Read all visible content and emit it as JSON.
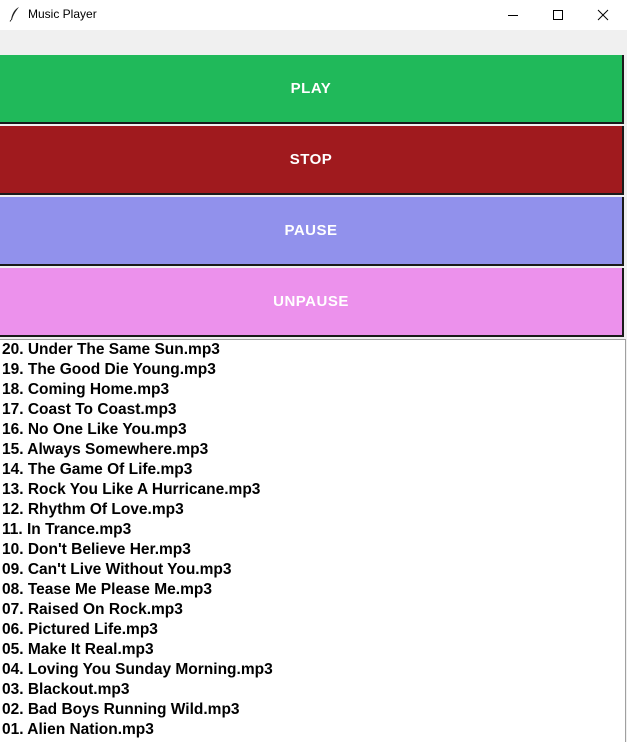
{
  "window": {
    "title": "Music Player",
    "icons": {
      "app": "feather-icon",
      "minimize": "minimize-icon",
      "maximize": "maximize-icon",
      "close": "close-icon"
    }
  },
  "controls": {
    "play": {
      "label": "PLAY",
      "color": "#20b95a"
    },
    "stop": {
      "label": "STOP",
      "color": "#a01a1e"
    },
    "pause": {
      "label": "PAUSE",
      "color": "#9191ec"
    },
    "unpause": {
      "label": "UNPAUSE",
      "color": "#ec91ec"
    }
  },
  "playlist": {
    "tracks": [
      "20. Under The Same Sun.mp3",
      "19. The Good Die Young.mp3",
      "18. Coming Home.mp3",
      "17. Coast To Coast.mp3",
      "16. No One Like You.mp3",
      "15. Always Somewhere.mp3",
      "14. The Game Of Life.mp3",
      "13. Rock You Like A Hurricane.mp3",
      "12. Rhythm Of Love.mp3",
      "11. In Trance.mp3",
      "10. Don't Believe Her.mp3",
      "09. Can't Live Without You.mp3",
      "08. Tease Me Please Me.mp3",
      "07. Raised On Rock.mp3",
      "06. Pictured Life.mp3",
      "05. Make It Real.mp3",
      "04. Loving You Sunday Morning.mp3",
      "03. Blackout.mp3",
      "02. Bad Boys Running Wild.mp3",
      "01. Alien Nation.mp3"
    ]
  }
}
